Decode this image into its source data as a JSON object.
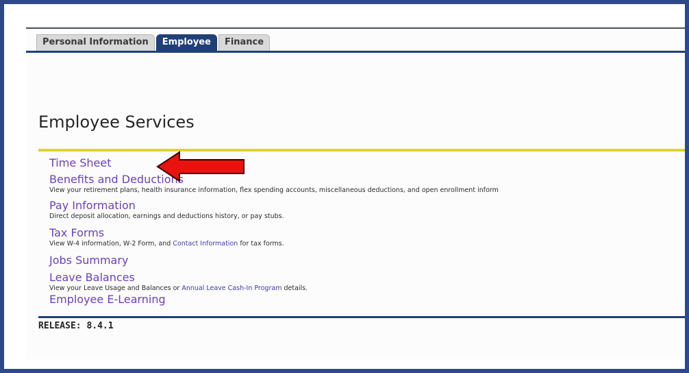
{
  "tabs": [
    {
      "label": "Personal Information",
      "active": false
    },
    {
      "label": "Employee",
      "active": true
    },
    {
      "label": "Finance",
      "active": false
    }
  ],
  "page_title": "Employee Services",
  "menu": {
    "time_sheet": {
      "label": "Time Sheet"
    },
    "benefits": {
      "label": "Benefits and Deductions",
      "description": "View your retirement plans, health insurance information, flex spending accounts, miscellaneous deductions, and open enrollment inform"
    },
    "pay": {
      "label": "Pay Information",
      "description": "Direct deposit allocation, earnings and deductions history, or pay stubs."
    },
    "tax": {
      "label": "Tax Forms",
      "description_prefix": "View W-4 information, W-2 Form, and",
      "description_link": "Contact Information",
      "description_suffix": "for tax forms."
    },
    "jobs": {
      "label": "Jobs Summary"
    },
    "leave": {
      "label": "Leave Balances",
      "description_prefix": "View your Leave Usage and Balances or",
      "description_link": "Annual Leave Cash-In Program",
      "description_suffix": "details."
    },
    "elearning": {
      "label": "Employee E-Learning"
    }
  },
  "release": "RELEASE: 8.4.1",
  "annotation": {
    "type": "arrow",
    "color": "#e8120e",
    "points_to": "Time Sheet"
  },
  "colors": {
    "frame": "#2d4a86",
    "tab_active": "#1f3f78",
    "link": "#6a3fbf",
    "divider_yellow": "#dcd434"
  }
}
